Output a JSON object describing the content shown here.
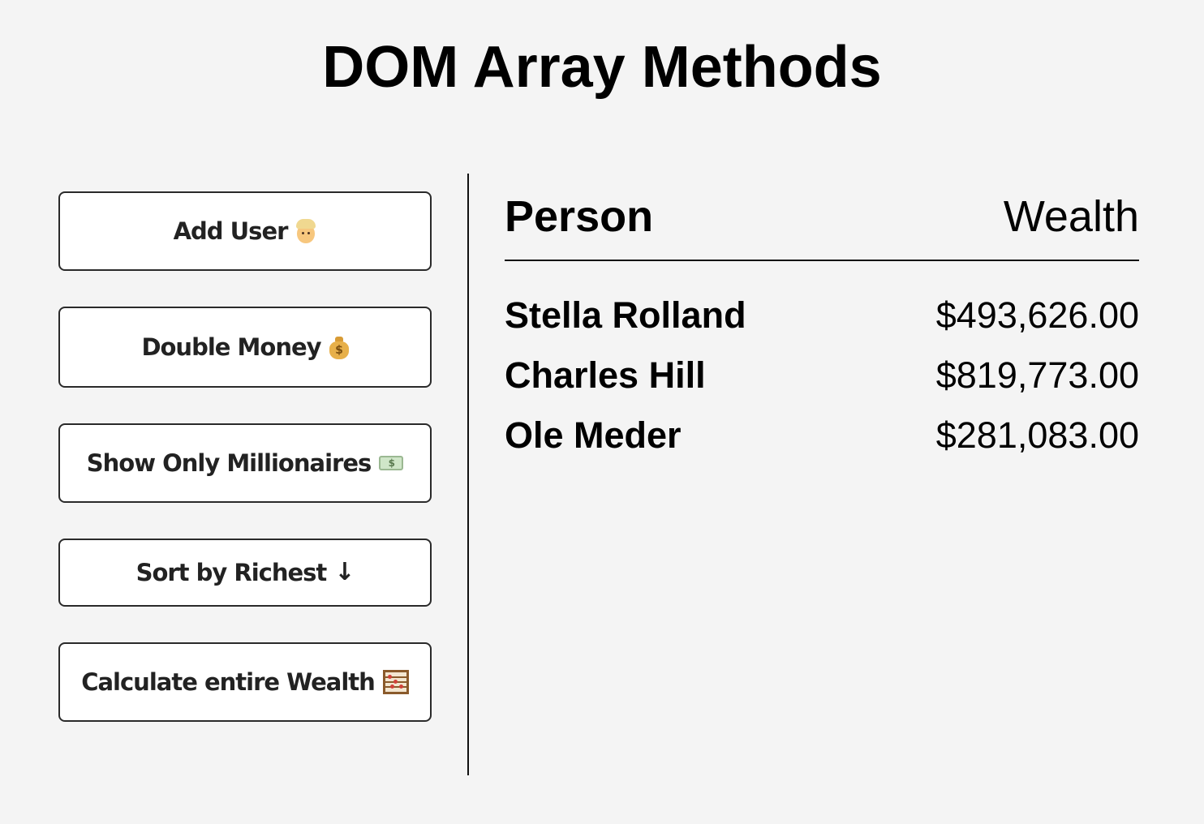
{
  "title": "DOM Array Methods",
  "buttons": [
    {
      "label": "Add User",
      "icon": "man-blond-icon"
    },
    {
      "label": "Double Money",
      "icon": "money-bag-icon"
    },
    {
      "label": "Show Only Millionaires",
      "icon": "dollar-banknote-icon"
    },
    {
      "label": "Sort by Richest",
      "icon": "arrow-down-icon"
    },
    {
      "label": "Calculate entire Wealth",
      "icon": "abacus-icon"
    }
  ],
  "table": {
    "person_header": "Person",
    "wealth_header": "Wealth",
    "rows": [
      {
        "name": "Stella Rolland",
        "wealth": "$493,626.00"
      },
      {
        "name": "Charles Hill",
        "wealth": "$819,773.00"
      },
      {
        "name": "Ole Meder",
        "wealth": "$281,083.00"
      }
    ]
  }
}
